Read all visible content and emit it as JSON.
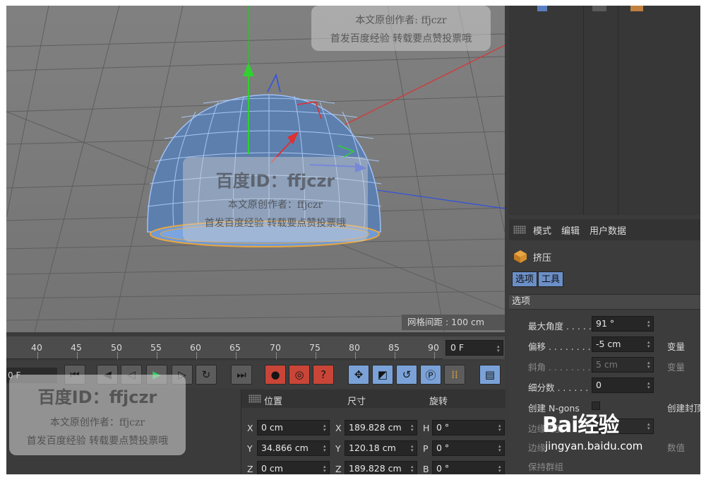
{
  "viewport": {
    "grid_spacing_label": "网格间距 : 100 cm"
  },
  "attributes": {
    "menu": [
      "模式",
      "编辑",
      "用户数据"
    ],
    "object_name": "挤压",
    "tabs": [
      "选项",
      "工具"
    ],
    "section": "选项",
    "props": [
      {
        "label": "最大角度",
        "value": "91 °",
        "right": ""
      },
      {
        "label": "偏移",
        "value": "-5 cm",
        "right": "变量"
      },
      {
        "label": "斜角",
        "value": "5 cm",
        "right": "变量"
      },
      {
        "label": "细分数",
        "value": "0",
        "right": ""
      },
      {
        "label": "创建 N-gons",
        "value": "",
        "right": "创建封顶"
      },
      {
        "label": "边缘角度",
        "value": "",
        "right": ""
      },
      {
        "label": "边缘",
        "value": "",
        "right": "数值"
      },
      {
        "label": "保持群组",
        "value": "",
        "right": ""
      }
    ]
  },
  "timeline": {
    "ticks": [
      "40",
      "45",
      "50",
      "55",
      "60",
      "65",
      "70",
      "75",
      "80",
      "85",
      "90"
    ],
    "current_frame": "0 F",
    "start_frame": "0 F"
  },
  "coordinates": {
    "headers": {
      "position": "位置",
      "size": "尺寸",
      "rotation": "旋转"
    },
    "rows": [
      {
        "axis": "X",
        "position": "0 cm",
        "size_axis": "X",
        "size": "189.828 cm",
        "rot_axis": "H",
        "rotation": "0 °"
      },
      {
        "axis": "Y",
        "position": "34.866 cm",
        "size_axis": "Y",
        "size": "120.18 cm",
        "rot_axis": "P",
        "rotation": "0 °"
      },
      {
        "axis": "Z",
        "position": "0 cm",
        "size_axis": "Z",
        "size": "189.828 cm",
        "rot_axis": "B",
        "rotation": "0 °"
      }
    ]
  },
  "watermarks": {
    "id_text": "百度ID：ffjczr",
    "author_line": "本文原创作者：ffjczr",
    "promo_line": "首发百度经验 转载要点赞投票哦",
    "top_author_line": "本文原创作者: ffjczr",
    "top_promo_line": "首发百度经验 转载要点赞投票哦"
  },
  "brand": {
    "logo_text": "Bai经验",
    "url": "jingyan.baidu.com"
  },
  "colors": {
    "axis_x": "#e03030",
    "axis_y": "#30c030",
    "axis_z": "#3050e0",
    "mesh": "#8fb6f0",
    "accent_tab": "#6b8fc7",
    "record": "#c94538"
  }
}
